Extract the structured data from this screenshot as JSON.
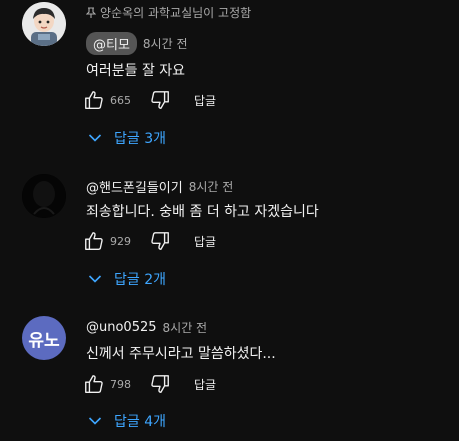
{
  "colors": {
    "background": "#0f0f0f",
    "text": "#f1f1f1",
    "muted": "#aaaaaa",
    "link": "#3ea6ff",
    "chip": "#555555",
    "avatar_uno": "#5c6bc0"
  },
  "comments": [
    {
      "pinned_label": "양순옥의 과학교실님이 고정함",
      "author": "@티모",
      "time": "8시간 전",
      "text": "여러분들 잘 자요",
      "likes": "665",
      "reply_label": "답글",
      "replies_label": "답글 3개"
    },
    {
      "author": "@핸드폰길들이기",
      "time": "8시간 전",
      "text": "죄송합니다. 숭배 좀 더 하고 자겠습니다",
      "likes": "929",
      "reply_label": "답글",
      "replies_label": "답글 2개"
    },
    {
      "avatar_initials": "유노",
      "author": "@uno0525",
      "time": "8시간 전",
      "text": "신께서 주무시라고 말씀하셨다...",
      "likes": "798",
      "reply_label": "답글",
      "replies_label": "답글 4개"
    }
  ]
}
